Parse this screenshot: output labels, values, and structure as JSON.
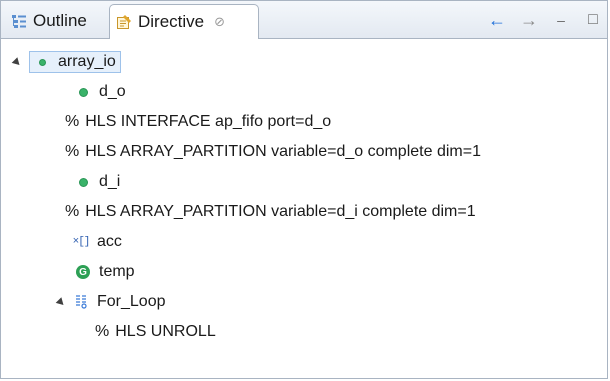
{
  "tabs": {
    "outline_label": "Outline",
    "directive_label": "Directive",
    "close_glyph": "⊘"
  },
  "toolbar": {
    "back_glyph": "←",
    "forward_glyph": "→",
    "minimize_glyph": "–",
    "maximize_glyph": "□"
  },
  "tree": {
    "root": {
      "label": "array_io",
      "icon": "function-dot-icon",
      "expanded": true,
      "selected": true
    },
    "items": [
      {
        "icon": "port-dot-icon",
        "label": "d_o"
      },
      {
        "prefix": "%",
        "label": "HLS INTERFACE ap_fifo port=d_o"
      },
      {
        "prefix": "%",
        "label": "HLS ARRAY_PARTITION variable=d_o complete dim=1"
      },
      {
        "icon": "port-dot-icon",
        "label": "d_i"
      },
      {
        "prefix": "%",
        "label": "HLS ARRAY_PARTITION variable=d_i complete dim=1"
      },
      {
        "icon": "array-variable-icon",
        "icon_text": "×[]",
        "label": "acc"
      },
      {
        "icon": "global-variable-icon",
        "icon_text": "G",
        "label": "temp"
      },
      {
        "icon": "loop-icon",
        "label": "For_Loop",
        "expanded": true
      },
      {
        "prefix": "%",
        "label": "HLS UNROLL"
      }
    ]
  },
  "colors": {
    "accent_blue": "#1e6fd9",
    "icon_green": "#3ab36a",
    "selection_bg": "#e6f0fb",
    "border": "#a9b4c2"
  }
}
